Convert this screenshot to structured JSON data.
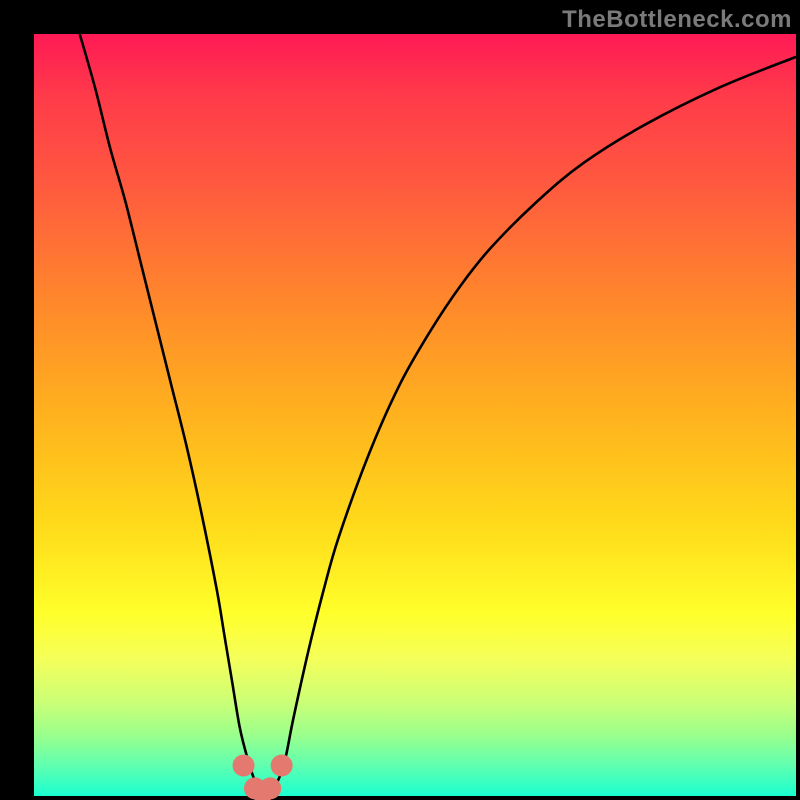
{
  "watermark": "TheBottleneck.com",
  "chart_data": {
    "type": "line",
    "title": "",
    "xlabel": "",
    "ylabel": "",
    "xlim": [
      0,
      100
    ],
    "ylim": [
      0,
      100
    ],
    "series": [
      {
        "name": "bottleneck-curve",
        "x": [
          6,
          8,
          10,
          12,
          14,
          16,
          18,
          20,
          22,
          24,
          25,
          26,
          27,
          28,
          29,
          30,
          31,
          32,
          33,
          34,
          36,
          38,
          40,
          44,
          48,
          52,
          56,
          60,
          66,
          72,
          80,
          90,
          100
        ],
        "y": [
          100,
          93,
          85,
          78,
          70,
          62,
          54,
          46,
          37,
          27,
          21,
          15,
          9,
          5,
          2,
          1,
          1,
          2,
          5,
          10,
          19,
          27,
          34,
          45,
          54,
          61,
          67,
          72,
          78,
          83,
          88,
          93,
          97
        ]
      }
    ],
    "markers": [
      {
        "x": 27.5,
        "y": 4
      },
      {
        "x": 29.0,
        "y": 1
      },
      {
        "x": 30.0,
        "y": 0.5
      },
      {
        "x": 31.0,
        "y": 1
      },
      {
        "x": 32.5,
        "y": 4
      }
    ],
    "colors": {
      "curve": "#000000",
      "marker": "#e4796f"
    }
  }
}
